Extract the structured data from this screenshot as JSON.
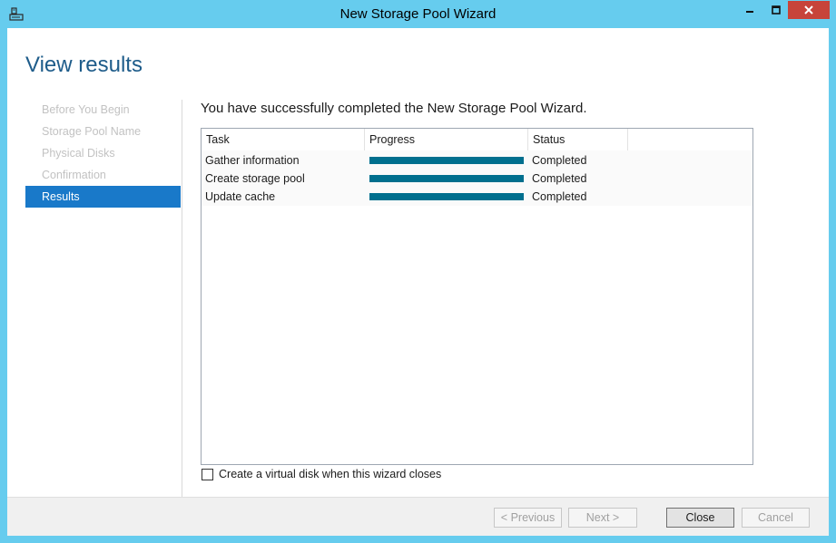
{
  "window": {
    "title": "New Storage Pool Wizard",
    "frame_color": "#66ccee",
    "close_color": "#c7443a"
  },
  "page": {
    "title": "View results",
    "message": "You have successfully completed the New Storage Pool Wizard."
  },
  "nav": {
    "items": [
      {
        "label": "Before You Begin",
        "active": false
      },
      {
        "label": "Storage Pool Name",
        "active": false
      },
      {
        "label": "Physical Disks",
        "active": false
      },
      {
        "label": "Confirmation",
        "active": false
      },
      {
        "label": "Results",
        "active": true
      }
    ],
    "active_color": "#1979c9"
  },
  "results": {
    "columns": [
      "Task",
      "Progress",
      "Status"
    ],
    "rows": [
      {
        "task": "Gather information",
        "progress": 1.0,
        "status": "Completed"
      },
      {
        "task": "Create storage pool",
        "progress": 1.0,
        "status": "Completed"
      },
      {
        "task": "Update cache",
        "progress": 1.0,
        "status": "Completed"
      }
    ],
    "progress_color": "#006f8e"
  },
  "options": {
    "create_virtual_disk_label": "Create a virtual disk when this wizard closes",
    "create_virtual_disk_checked": false
  },
  "buttons": {
    "previous": "< Previous",
    "next": "Next >",
    "close": "Close",
    "cancel": "Cancel"
  }
}
